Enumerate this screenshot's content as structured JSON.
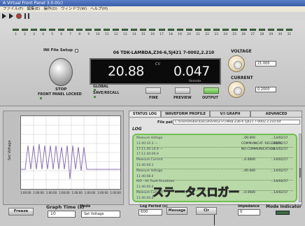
{
  "window": {
    "title": "A Virtual Front Panel 3.0.0(c)"
  },
  "menu": [
    "ファイル(F)",
    "編集(E)",
    "操作(O)",
    "ウィンドウ(W)",
    "ヘルプ(H)"
  ],
  "channels": [
    "1",
    "2",
    "3",
    "4",
    "5",
    "6",
    "7",
    "8",
    "9",
    "10",
    "11",
    "12",
    "13",
    "14",
    "15",
    "16",
    "17",
    "18",
    "19",
    "20",
    "21",
    "22",
    "23",
    "24",
    "25",
    "26",
    "27",
    "28",
    "29",
    "30",
    "31"
  ],
  "ini_file": {
    "label": "INI File Setup"
  },
  "device": {
    "header": "06    TDK-LAMBDA,Z36-6,5J421 7-0002,2.210",
    "voltage_reading": "20.88",
    "current_reading": "0.047",
    "mode_text": "CV",
    "remote_text": "Remote",
    "stop_label": "STOP",
    "front_panel_locked": "FRONT PANEL LOCKED",
    "global_label": "GLOBAL",
    "save_recall_label": "SAVE/RECALL",
    "fine_label": "FINE",
    "preview_label": "PREVIEW",
    "output_label": "OUTPUT"
  },
  "voltage": {
    "label": "VOLTAGE",
    "value": "21.000"
  },
  "current": {
    "label": "CURRENT",
    "value": "0.2000"
  },
  "graph": {
    "ylabel": "Set Voltage",
    "xticks": [
      "1:00:00",
      "1:00:00",
      "1:00:00",
      "1:00:00",
      "1:00:00",
      "1:00:00",
      "1:00:00",
      "1:00:00"
    ],
    "freeze_label": "Freeze",
    "graph_time_label": "Graph Time (s)",
    "graph_time_value": "10",
    "mode_label": "Mode",
    "mode_value": "Set Voltage"
  },
  "tabs": [
    "STATUS LOG",
    "WAVEFORM PROFILE",
    "V/I GRAPH",
    "ADVANCED"
  ],
  "status_log": {
    "title": "LOG",
    "file_path_label": "File path",
    "file_path_value": "C:\\Users\\Public\\Documents\\Z+\\TAKIB Z36-6 5J421 7-0002.2.210.txt",
    "lines": [
      {
        "desc": "Measure Voltage",
        "val": "...00.000",
        "date": "...14/02/17"
      },
      {
        "desc": "11:40:10.3 ---",
        "val": "COMMUNICAT. RECOVERY",
        "date": "...14/02/17"
      },
      {
        "desc": "17:11:40:10.9 ---",
        "val": "NO COMMUNICATION",
        "date": "...14/02/17"
      },
      {
        "desc": "17:11:40:09.9",
        "val": "",
        "date": ""
      },
      {
        "desc": "Measure Current",
        "val": "...0.0000",
        "date": "...14/02/17"
      },
      {
        "desc": "11:40:08.1",
        "val": "",
        "date": ""
      },
      {
        "desc": "Measure Voltage",
        "val": "...00.000",
        "date": "...14/02/17"
      },
      {
        "desc": "11:40:08.0",
        "val": "",
        "date": ""
      },
      {
        "desc": "IO1 - AC Fault Shutdown",
        "val": "",
        "date": "...14/02/17"
      },
      {
        "desc": "11:40:00.0",
        "val": "",
        "date": ""
      },
      {
        "desc": "Measure Current",
        "val": "...0.0000",
        "date": "...14/02/17"
      },
      {
        "desc": "11:40:00.0",
        "val": "",
        "date": ""
      }
    ]
  },
  "callout_label": "ステータスロガー",
  "log_controls": {
    "log_period_label": "Log Period (s)",
    "log_period_value": "600",
    "message_label": "Message",
    "clear_label": "Clr",
    "impedance_label": "Impedance",
    "impedance_value": "0",
    "mode_indicator_label": "Mode Indicator"
  }
}
